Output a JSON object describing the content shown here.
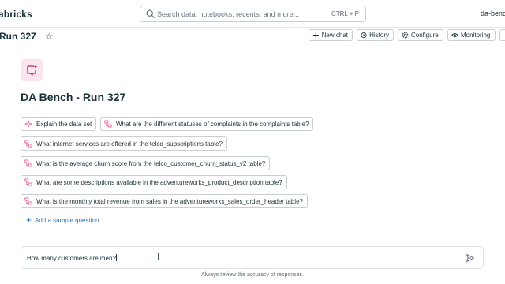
{
  "app": {
    "brand": "abricks",
    "workspace": "da-bench"
  },
  "search": {
    "placeholder": "Search data, notebooks, recents, and more...",
    "shortcut": "CTRL + P",
    "icon": "search-icon"
  },
  "page": {
    "title": "Run 327",
    "favorite_icon": "star-icon"
  },
  "toolbar": {
    "buttons": [
      {
        "label": "New chat",
        "icon": "plus-icon"
      },
      {
        "label": "History",
        "icon": "history-icon"
      },
      {
        "label": "Configure",
        "icon": "gear-icon"
      },
      {
        "label": "Monitoring",
        "icon": "eye-icon"
      }
    ]
  },
  "space": {
    "title": "DA Bench - Run 327",
    "logo_icon": "genie-sparkle-icon"
  },
  "sample_questions": [
    {
      "label": "Explain the data set",
      "icon": "sparkle-icon"
    },
    {
      "label": "What are the different statuses of complaints in the complaints table?",
      "icon": "table-query-icon"
    },
    {
      "label": "What internet services are offered in the telco_subscriptions table?",
      "icon": "table-query-icon"
    },
    {
      "label": "What is the average churn score from the telco_customer_churn_status_v2 table?",
      "icon": "table-query-icon"
    },
    {
      "label": "What are some descriptions available in the adventureworks_product_description table?",
      "icon": "table-query-icon"
    },
    {
      "label": "What is the monthly total revenue from sales in the adventureworks_sales_order_header table?",
      "icon": "table-query-icon"
    }
  ],
  "add_sample_label": "Add a sample question",
  "chat": {
    "input_value": "How many customers are men?",
    "send_icon": "send-icon"
  },
  "disclaimer": "Always review the accuracy of responses.",
  "colors": {
    "text": "#1b3139",
    "link": "#2272b4",
    "accent_pink": "#e35d9a",
    "logo_bg": "#fbe6ef",
    "border": "#c9ced3"
  }
}
